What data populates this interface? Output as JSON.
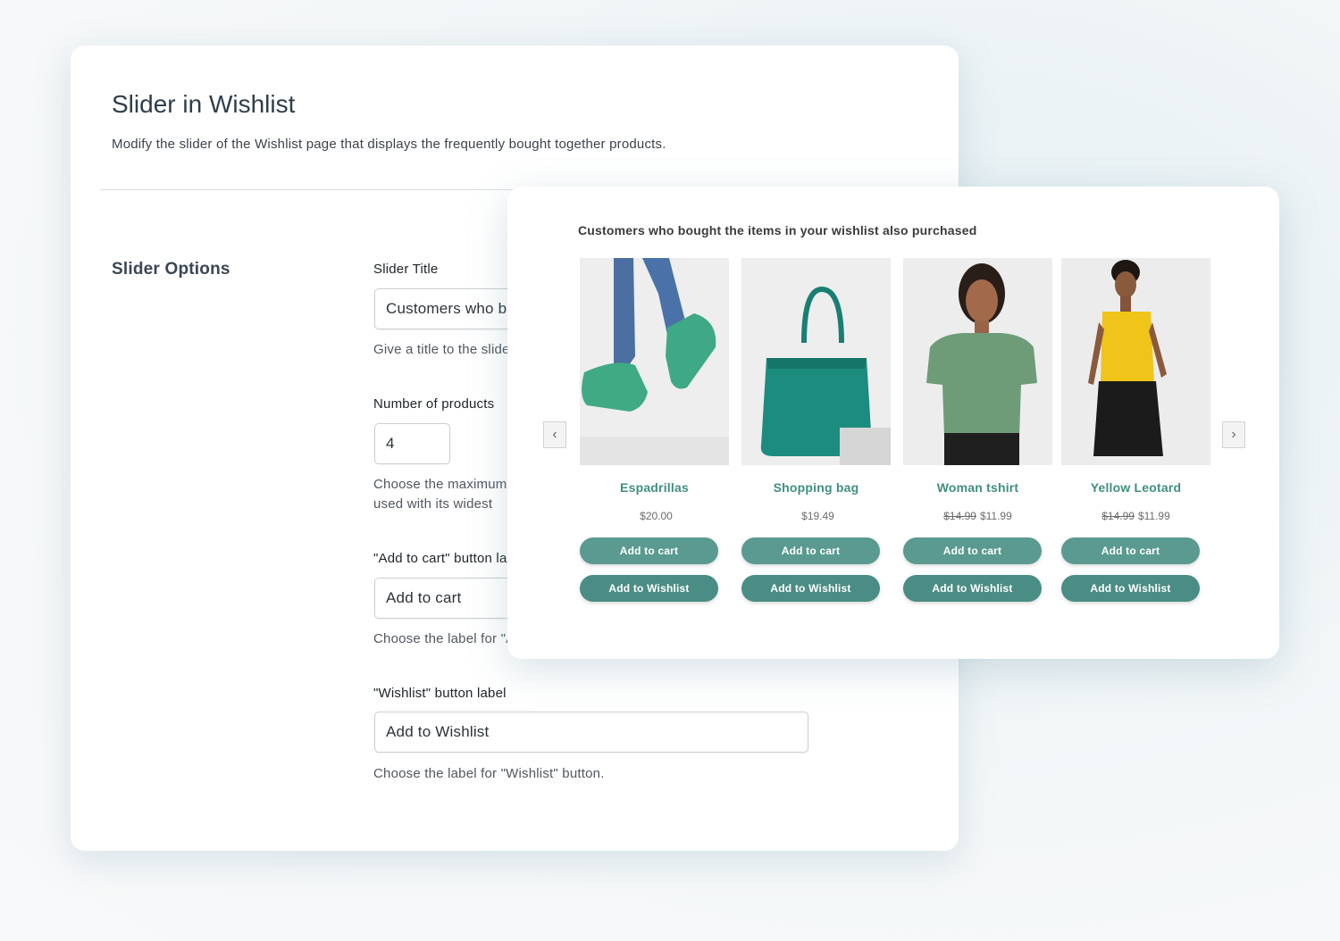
{
  "settings": {
    "title": "Slider in Wishlist",
    "description": "Modify the slider of the Wishlist page that displays the frequently bought together products.",
    "section": "Slider Options",
    "slider_title": {
      "label": "Slider Title",
      "value": "Customers who bought the items in your wishlist also purchased",
      "help": "Give a title to the slider."
    },
    "num_products": {
      "label": "Number of products",
      "value": "4",
      "help_line1": "Choose the maximum number of products",
      "help_line2": "used with its widest"
    },
    "cart_label": {
      "label": "\"Add to cart\" button label",
      "value": "Add to cart",
      "help": "Choose the label for \"Add to cart\" button."
    },
    "wishlist_label": {
      "label": "\"Wishlist\" button label",
      "value": "Add to Wishlist",
      "help": "Choose the label for \"Wishlist\" button."
    }
  },
  "preview": {
    "title": "Customers who bought the items in your wishlist also purchased",
    "prev_icon": "chevron-left-icon",
    "next_icon": "chevron-right-icon",
    "prev_glyph": "‹",
    "next_glyph": "›",
    "accent_color": "#4a8d84",
    "products": [
      {
        "name": "Espadrillas",
        "old_price": "",
        "price": "$20.00",
        "cart": "Add to cart",
        "wishlist": "Add to Wishlist"
      },
      {
        "name": "Shopping bag",
        "old_price": "",
        "price": "$19.49",
        "cart": "Add to cart",
        "wishlist": "Add to Wishlist"
      },
      {
        "name": "Woman tshirt",
        "old_price": "$14.99",
        "price": "$11.99",
        "cart": "Add to cart",
        "wishlist": "Add to Wishlist"
      },
      {
        "name": "Yellow Leotard",
        "old_price": "$14.99",
        "price": "$11.99",
        "cart": "Add to cart",
        "wishlist": "Add to Wishlist"
      }
    ]
  }
}
